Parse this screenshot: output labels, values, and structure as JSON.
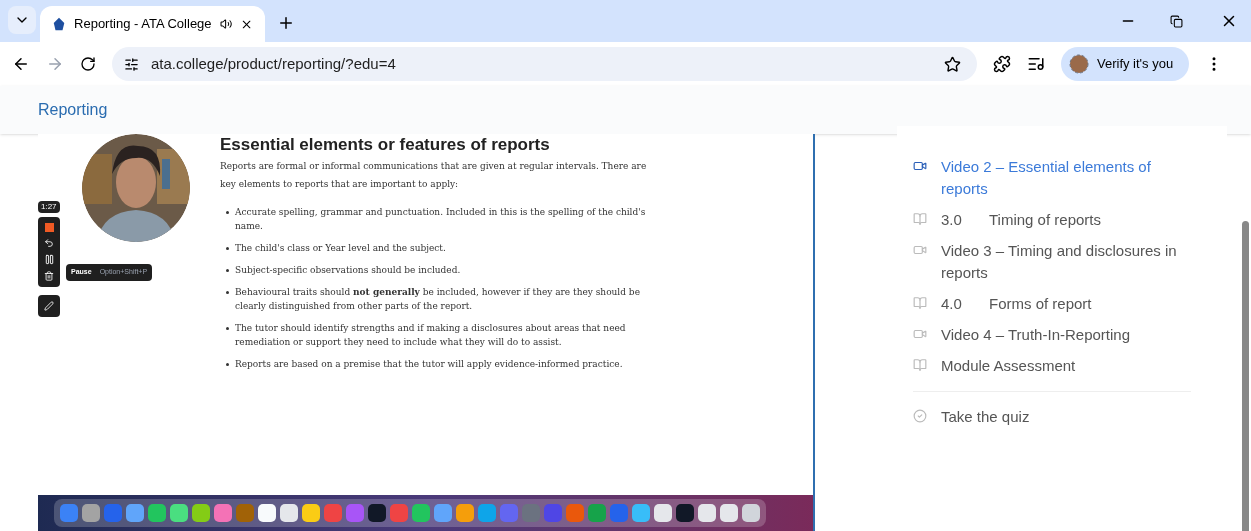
{
  "browser": {
    "tabs": [
      {
        "title": "Reporting - ATA College",
        "selected": true,
        "audio": true
      }
    ],
    "address": "ata.college/product/reporting/?edu=4",
    "profile": "Verify it's you"
  },
  "page": {
    "header": "Reporting"
  },
  "video": {
    "timer": "1:27",
    "tooltip": {
      "label": "Pause",
      "shortcut": "Option+Shift+P"
    },
    "slide": {
      "title": "Essential elements or features of reports",
      "intro": "Reports are formal or informal communications that are given at regular intervals. There are key elements to reports that are important to apply:",
      "bullets": [
        "Accurate spelling, grammar and punctuation. Included in this is the spelling of the child's name.",
        "The child's class or Year level and the subject.",
        "Subject-specific observations should be included.",
        "Behavioural traits should **not generally** be included, however if they are they should be clearly distinguished from other parts of the report.",
        "The tutor should identify strengths and if making a disclosures about areas that need remediation or support they need to include what they will do to assist.",
        "Reports are based on a premise that the tutor will apply evidence-informed practice."
      ]
    }
  },
  "sidebar": {
    "items": [
      {
        "kind": "video",
        "label": "Video 2 – Essential elements of reports",
        "selected": true
      },
      {
        "kind": "text",
        "number": "3.0",
        "label": "Timing of reports",
        "selected": false
      },
      {
        "kind": "video",
        "label": "Video 3 – Timing and disclosures in reports",
        "selected": false
      },
      {
        "kind": "text",
        "number": "4.0",
        "label": "Forms of report",
        "selected": false
      },
      {
        "kind": "video",
        "label": "Video 4 – Truth-In-Reporting",
        "selected": false
      },
      {
        "kind": "text",
        "label": "Module Assessment",
        "selected": false
      }
    ],
    "quiz": "Take the quiz"
  }
}
